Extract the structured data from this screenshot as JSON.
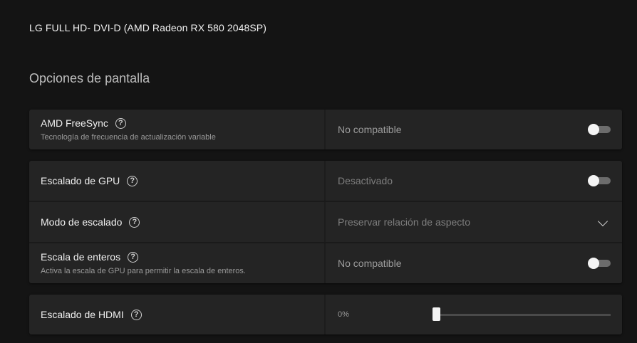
{
  "monitor": {
    "title": "LG FULL HD- DVI-D (AMD Radeon RX 580 2048SP)"
  },
  "section": {
    "title": "Opciones de pantalla"
  },
  "freesync": {
    "label": "AMD FreeSync",
    "sublabel": "Tecnología de frecuencia de actualización variable",
    "value": "No compatible",
    "enabled": false
  },
  "gpu_scaling": {
    "label": "Escalado de GPU",
    "value": "Desactivado",
    "enabled": false
  },
  "scaling_mode": {
    "label": "Modo de escalado",
    "value": "Preservar relación de aspecto"
  },
  "integer_scaling": {
    "label": "Escala de enteros",
    "sublabel": "Activa la escala de GPU para permitir la escala de enteros.",
    "value": "No compatible",
    "enabled": false
  },
  "hdmi_scaling": {
    "label": "Escalado de HDMI",
    "value": "0%",
    "level": 0
  },
  "icons": {
    "help": "?"
  }
}
